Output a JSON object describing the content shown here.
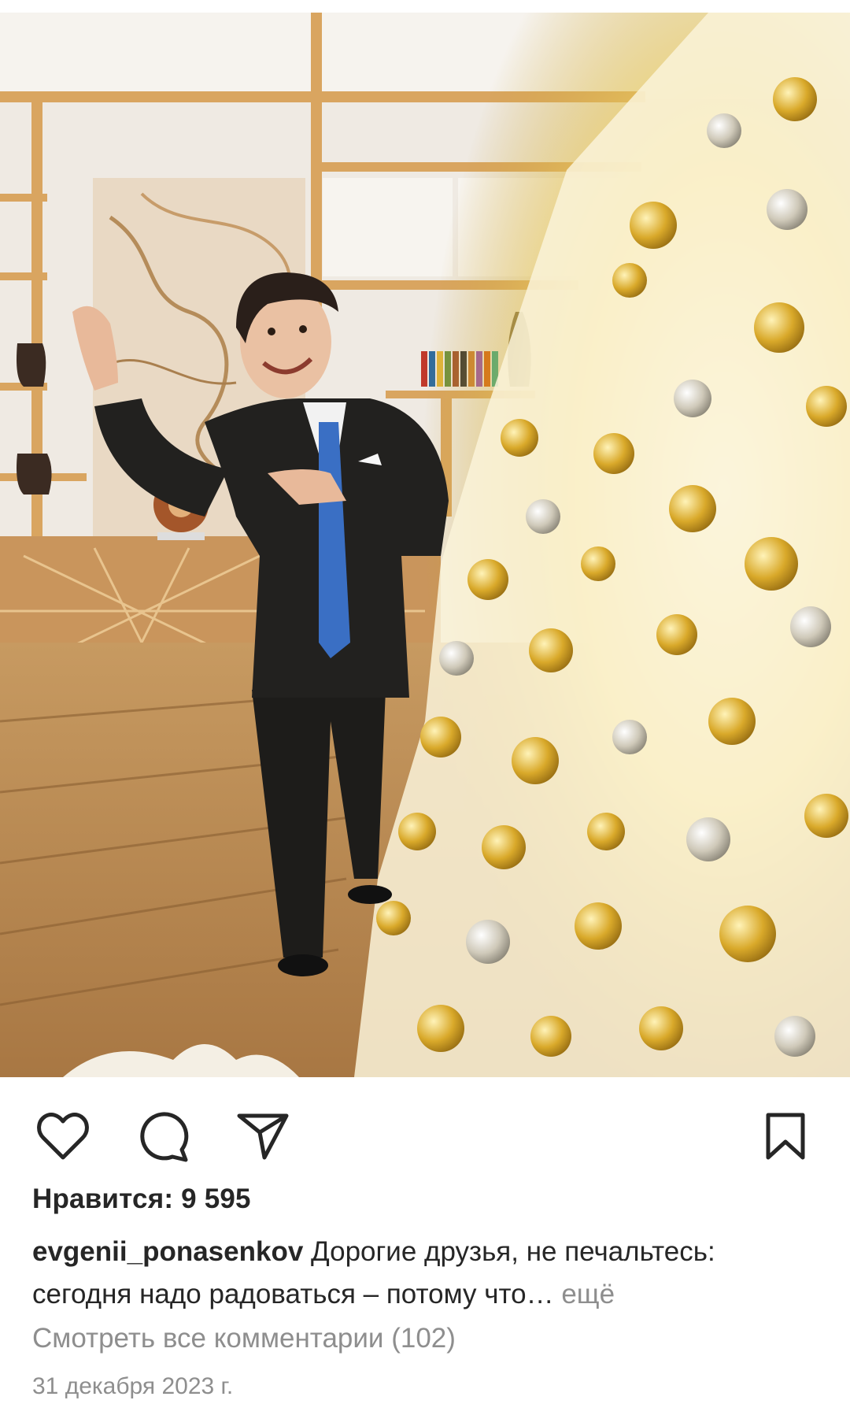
{
  "post": {
    "likes_label": "Нравится: 9 595",
    "username": "evgenii_ponasenkov",
    "caption_line1": "Дорогие друзья, не печальтесь:",
    "caption_line2": "сегодня надо радоваться – потому что…",
    "more_label": "ещё",
    "view_comments_label": "Смотреть все комментарии (102)",
    "date": "31 декабря 2023 г."
  },
  "icons": {
    "like": "heart-icon",
    "comment": "comment-icon",
    "share": "send-icon",
    "save": "bookmark-icon"
  },
  "colors": {
    "text": "#262626",
    "secondary": "#8e8e8e",
    "icon": "#262626"
  }
}
